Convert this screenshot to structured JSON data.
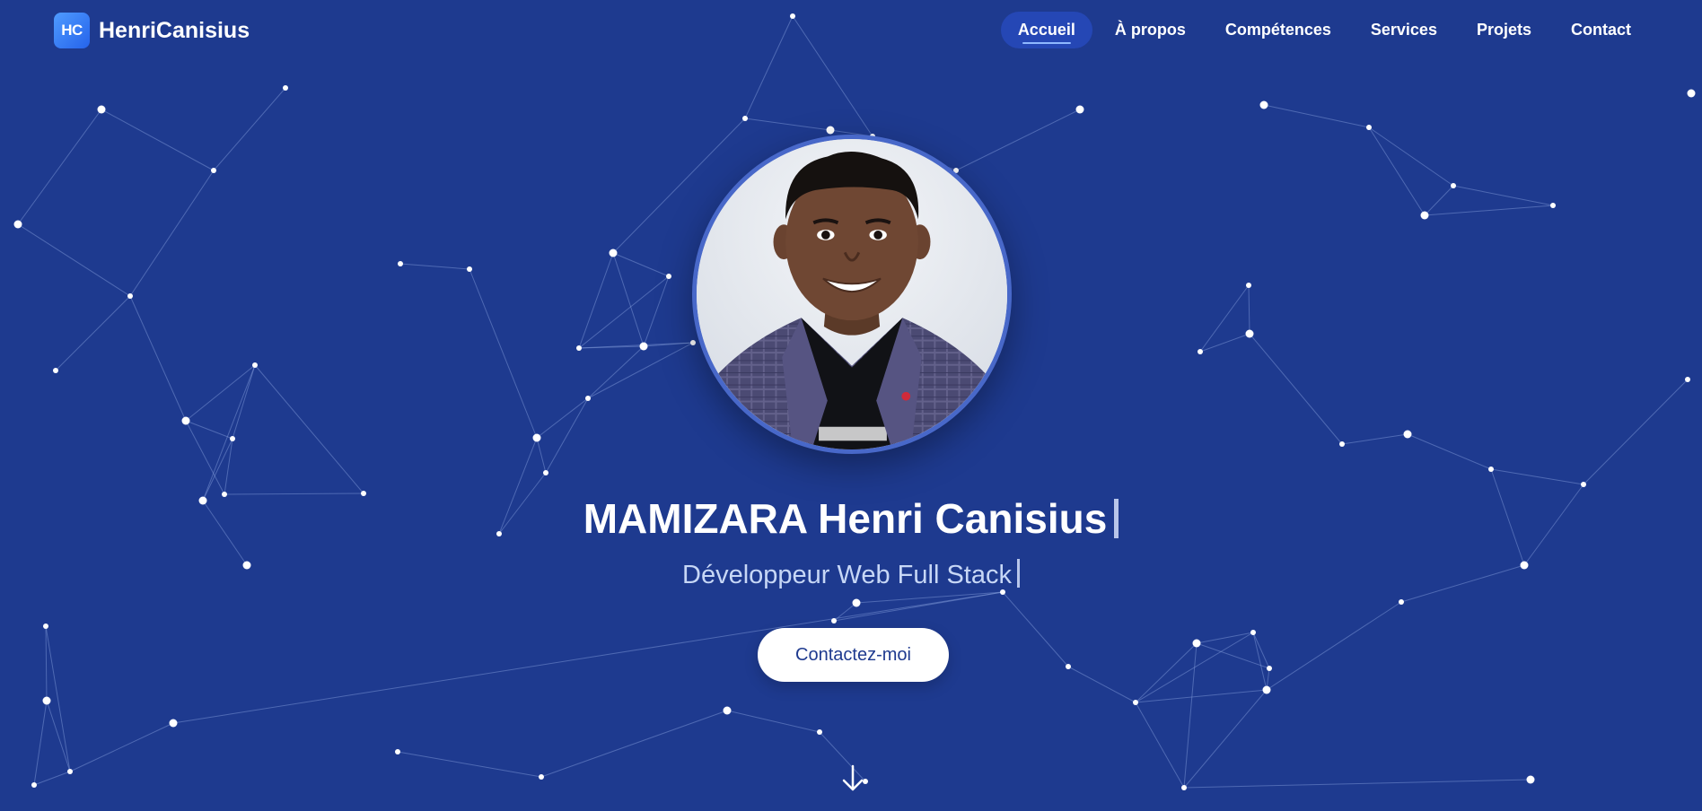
{
  "brand": {
    "badge": "HC",
    "name": "HenriCanisius"
  },
  "nav": {
    "items": [
      {
        "label": "Accueil",
        "active": true
      },
      {
        "label": "À propos",
        "active": false
      },
      {
        "label": "Compétences",
        "active": false
      },
      {
        "label": "Services",
        "active": false
      },
      {
        "label": "Projets",
        "active": false
      },
      {
        "label": "Contact",
        "active": false
      }
    ]
  },
  "hero": {
    "name": "MAMIZARA Henri Canisius",
    "subtitle": "Développeur Web Full Stack",
    "cta_label": "Contactez-moi",
    "avatar_icon": "profile-photo",
    "scroll_icon": "arrow-down-icon"
  },
  "colors": {
    "background": "#1e3a8f",
    "accent": "#2563eb",
    "nav_active_bg": "#2547b5",
    "text": "#ffffff",
    "subtitle": "#c7d7f6"
  }
}
